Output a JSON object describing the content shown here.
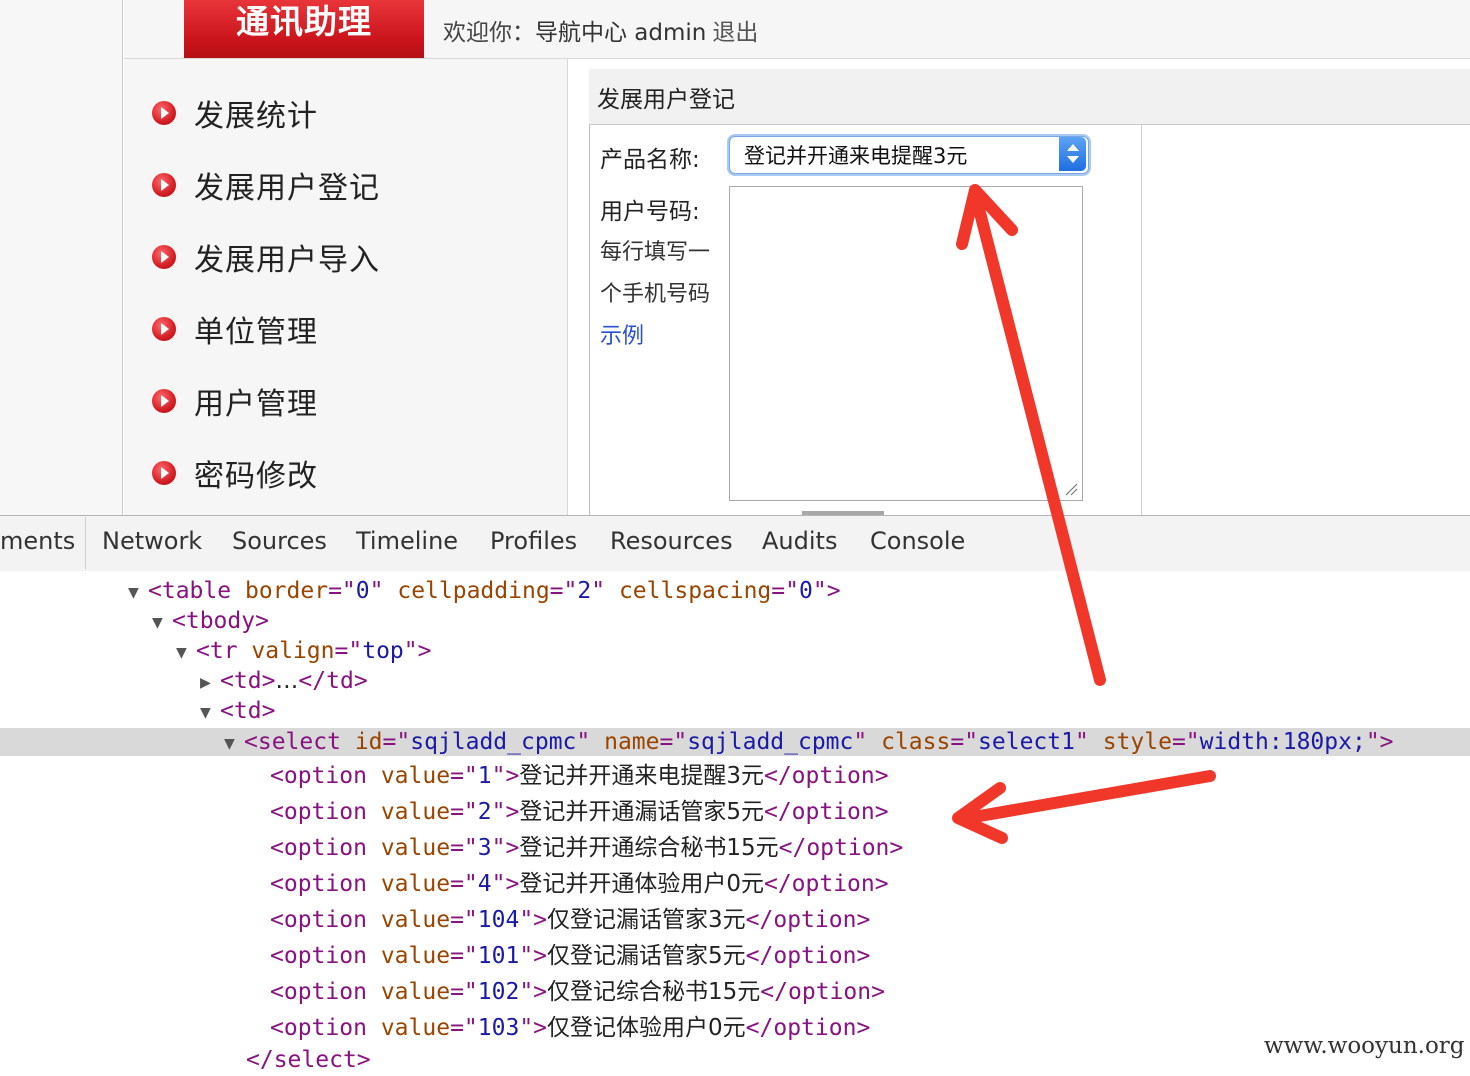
{
  "header": {
    "brand": "通讯助理",
    "welcome_prefix": "欢迎你：",
    "welcome_user": "导航中心 admin",
    "logout": "退出"
  },
  "sidebar": {
    "items": [
      {
        "label": "发展统计"
      },
      {
        "label": "发展用户登记"
      },
      {
        "label": "发展用户导入"
      },
      {
        "label": "单位管理"
      },
      {
        "label": "用户管理"
      },
      {
        "label": "密码修改"
      }
    ]
  },
  "form": {
    "title": "发展用户登记",
    "product_label": "产品名称:",
    "product_value": "登记并开通来电提醒3元",
    "phone_label": "用户号码:",
    "hint_line1": "每行填写一",
    "hint_line2": "个手机号码",
    "example_link": "示例",
    "phone_value": ""
  },
  "devtools": {
    "tabs": [
      "ments",
      "Network",
      "Sources",
      "Timeline",
      "Profiles",
      "Resources",
      "Audits",
      "Console"
    ],
    "table": {
      "tag": "table",
      "border": "0",
      "cellpadding": "2",
      "cellspacing": "0"
    },
    "tbody": "tbody",
    "tr": {
      "tag": "tr",
      "valign": "top"
    },
    "td_collapsed": "td",
    "td_collapsed_ellipsis": "…",
    "td_open": "td",
    "select": {
      "tag": "select",
      "id": "sqjladd_cpmc",
      "name": "sqjladd_cpmc",
      "class": "select1",
      "style": "width:180px;"
    },
    "options": [
      {
        "value": "1",
        "text": "登记并开通来电提醒3元"
      },
      {
        "value": "2",
        "text": "登记并开通漏话管家5元"
      },
      {
        "value": "3",
        "text": "登记并开通综合秘书15元"
      },
      {
        "value": "4",
        "text": "登记并开通体验用户0元"
      },
      {
        "value": "104",
        "text": "仅登记漏话管家3元"
      },
      {
        "value": "101",
        "text": "仅登记漏话管家5元"
      },
      {
        "value": "102",
        "text": "仅登记综合秘书15元"
      },
      {
        "value": "103",
        "text": "仅登记体验用户0元"
      }
    ],
    "select_close": "/select"
  },
  "watermark": "www.wooyun.org",
  "colors": {
    "brand_red": "#d41d24",
    "annotation_arrow": "#f0372a",
    "link_blue": "#2a4fd1"
  }
}
